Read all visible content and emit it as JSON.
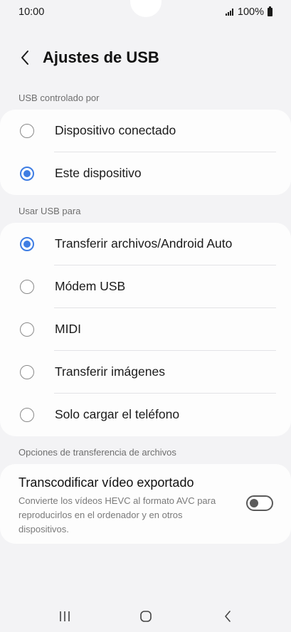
{
  "status_bar": {
    "time": "10:00",
    "battery_text": "100%",
    "icons": [
      "signal-icon",
      "battery-icon"
    ]
  },
  "header": {
    "title": "Ajustes de USB",
    "back_icon": "back-arrow-icon"
  },
  "usb_controlled_by": {
    "section_label": "USB controlado por",
    "options": [
      {
        "label": "Dispositivo conectado",
        "selected": false
      },
      {
        "label": "Este dispositivo",
        "selected": true
      }
    ]
  },
  "use_usb_for": {
    "section_label": "Usar USB para",
    "options": [
      {
        "label": "Transferir archivos/Android Auto",
        "selected": true
      },
      {
        "label": "Módem USB",
        "selected": false
      },
      {
        "label": "MIDI",
        "selected": false
      },
      {
        "label": "Transferir imágenes",
        "selected": false
      },
      {
        "label": "Solo cargar el teléfono",
        "selected": false
      }
    ]
  },
  "file_transfer_options": {
    "section_label": "Opciones de transferencia de archivos",
    "transcode": {
      "title": "Transcodificar vídeo exportado",
      "description": "Convierte los vídeos HEVC al formato AVC para reproducirlos en el ordenador y en otros dispositivos.",
      "enabled": false
    }
  },
  "nav_bar": {
    "icons": [
      "recent-apps-icon",
      "home-icon",
      "back-icon"
    ]
  },
  "colors": {
    "accent": "#3e7de3",
    "background": "#f3f3f5",
    "card": "#fdfdfd"
  }
}
